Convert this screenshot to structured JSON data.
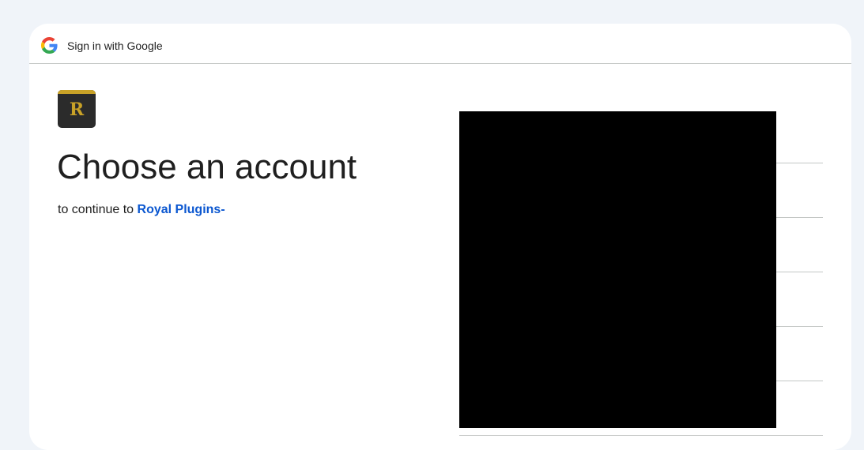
{
  "header": {
    "title": "Sign in with Google",
    "logo_icon": "google-g-icon"
  },
  "app": {
    "logo_letter": "R",
    "logo_colors": {
      "background": "#2b2b2b",
      "accent": "#c9a227"
    }
  },
  "main": {
    "title": "Choose an account",
    "subtitle_prefix": "to continue to ",
    "app_name": "Royal Plugins-"
  },
  "accounts": {
    "redacted": true,
    "row_count": 5
  },
  "colors": {
    "link": "#0b57d0",
    "page_background": "#f0f4f9",
    "divider": "#c4c7c5"
  }
}
